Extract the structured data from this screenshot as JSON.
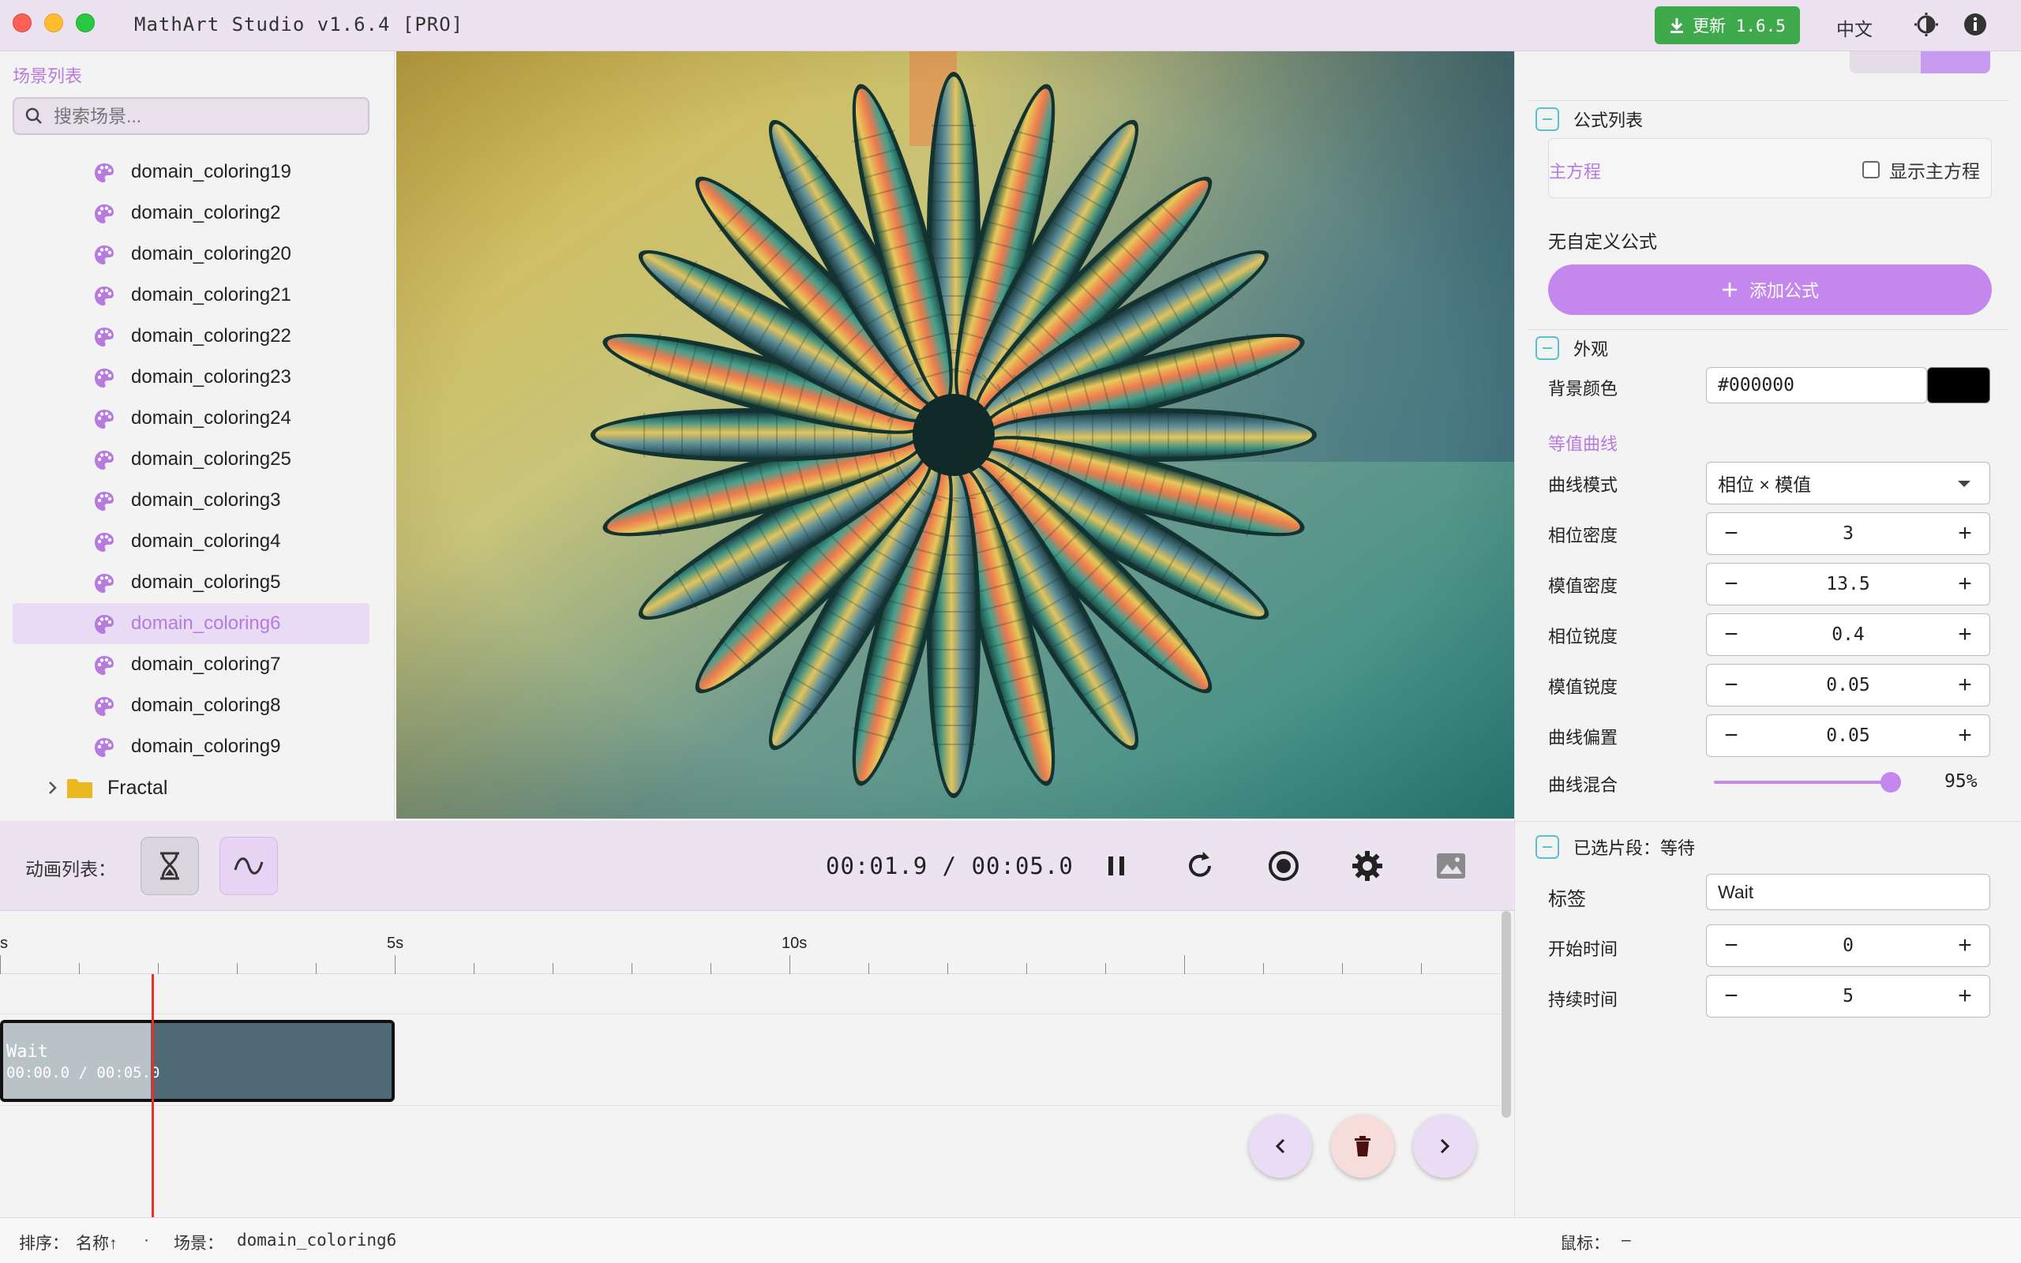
{
  "app": {
    "title": "MathArt Studio v1.6.4 [PRO]",
    "update_label": "更新 1.6.5",
    "language": "中文",
    "accent_color": "#c487ee",
    "update_color": "#3faa4c"
  },
  "sidebar": {
    "title": "场景列表",
    "search_placeholder": "搜索场景...",
    "items": [
      {
        "label": "domain_coloring19",
        "icon": "palette-icon"
      },
      {
        "label": "domain_coloring2",
        "icon": "palette-icon"
      },
      {
        "label": "domain_coloring20",
        "icon": "palette-icon"
      },
      {
        "label": "domain_coloring21",
        "icon": "palette-icon"
      },
      {
        "label": "domain_coloring22",
        "icon": "palette-icon"
      },
      {
        "label": "domain_coloring23",
        "icon": "palette-icon"
      },
      {
        "label": "domain_coloring24",
        "icon": "palette-icon"
      },
      {
        "label": "domain_coloring25",
        "icon": "palette-icon"
      },
      {
        "label": "domain_coloring3",
        "icon": "palette-icon"
      },
      {
        "label": "domain_coloring4",
        "icon": "palette-icon"
      },
      {
        "label": "domain_coloring5",
        "icon": "palette-icon"
      },
      {
        "label": "domain_coloring6",
        "icon": "palette-icon",
        "selected": true
      },
      {
        "label": "domain_coloring7",
        "icon": "palette-icon"
      },
      {
        "label": "domain_coloring8",
        "icon": "palette-icon"
      },
      {
        "label": "domain_coloring9",
        "icon": "palette-icon"
      }
    ],
    "folder": {
      "label": "Fractal",
      "icon": "folder-icon"
    }
  },
  "formulas": {
    "section_title": "公式列表",
    "main_eq_label": "主方程",
    "show_main_eq_label": "显示主方程",
    "show_main_eq_checked": false,
    "no_custom_label": "无自定义公式",
    "add_formula_label": "添加公式"
  },
  "appearance": {
    "section_title": "外观",
    "bg_color_label": "背景颜色",
    "bg_color_value": "#000000",
    "contour_header": "等值曲线",
    "curve_mode_label": "曲线模式",
    "curve_mode_value": "相位 × 模值",
    "steppers": [
      {
        "label": "相位密度",
        "value": "3"
      },
      {
        "label": "模值密度",
        "value": "13.5"
      },
      {
        "label": "相位锐度",
        "value": "0.4"
      },
      {
        "label": "模值锐度",
        "value": "0.05"
      },
      {
        "label": "曲线偏置",
        "value": "0.05"
      }
    ],
    "blend_label": "曲线混合",
    "blend_value": 95,
    "blend_text": "95%"
  },
  "animation": {
    "list_label": "动画列表：",
    "time_display": "00:01.9 / 00:05.0",
    "current_time": 1.9,
    "total_time": 5.0
  },
  "timeline": {
    "tick_labels": [
      "s",
      "5s",
      "10s"
    ],
    "clip": {
      "title": "Wait",
      "time": "00:00.0 / 00:05.0"
    }
  },
  "selected_clip": {
    "section_title": "已选片段：等待",
    "tag_label": "标签",
    "tag_value": "Wait",
    "start_label": "开始时间",
    "start_value": "0",
    "duration_label": "持续时间",
    "duration_value": "5"
  },
  "status": {
    "sort_label": "排序：",
    "sort_value": "名称↑",
    "separator": "·",
    "scene_label": "场景：",
    "scene_value": "domain_coloring6",
    "mouse_label": "鼠标：",
    "mouse_value": "–"
  }
}
